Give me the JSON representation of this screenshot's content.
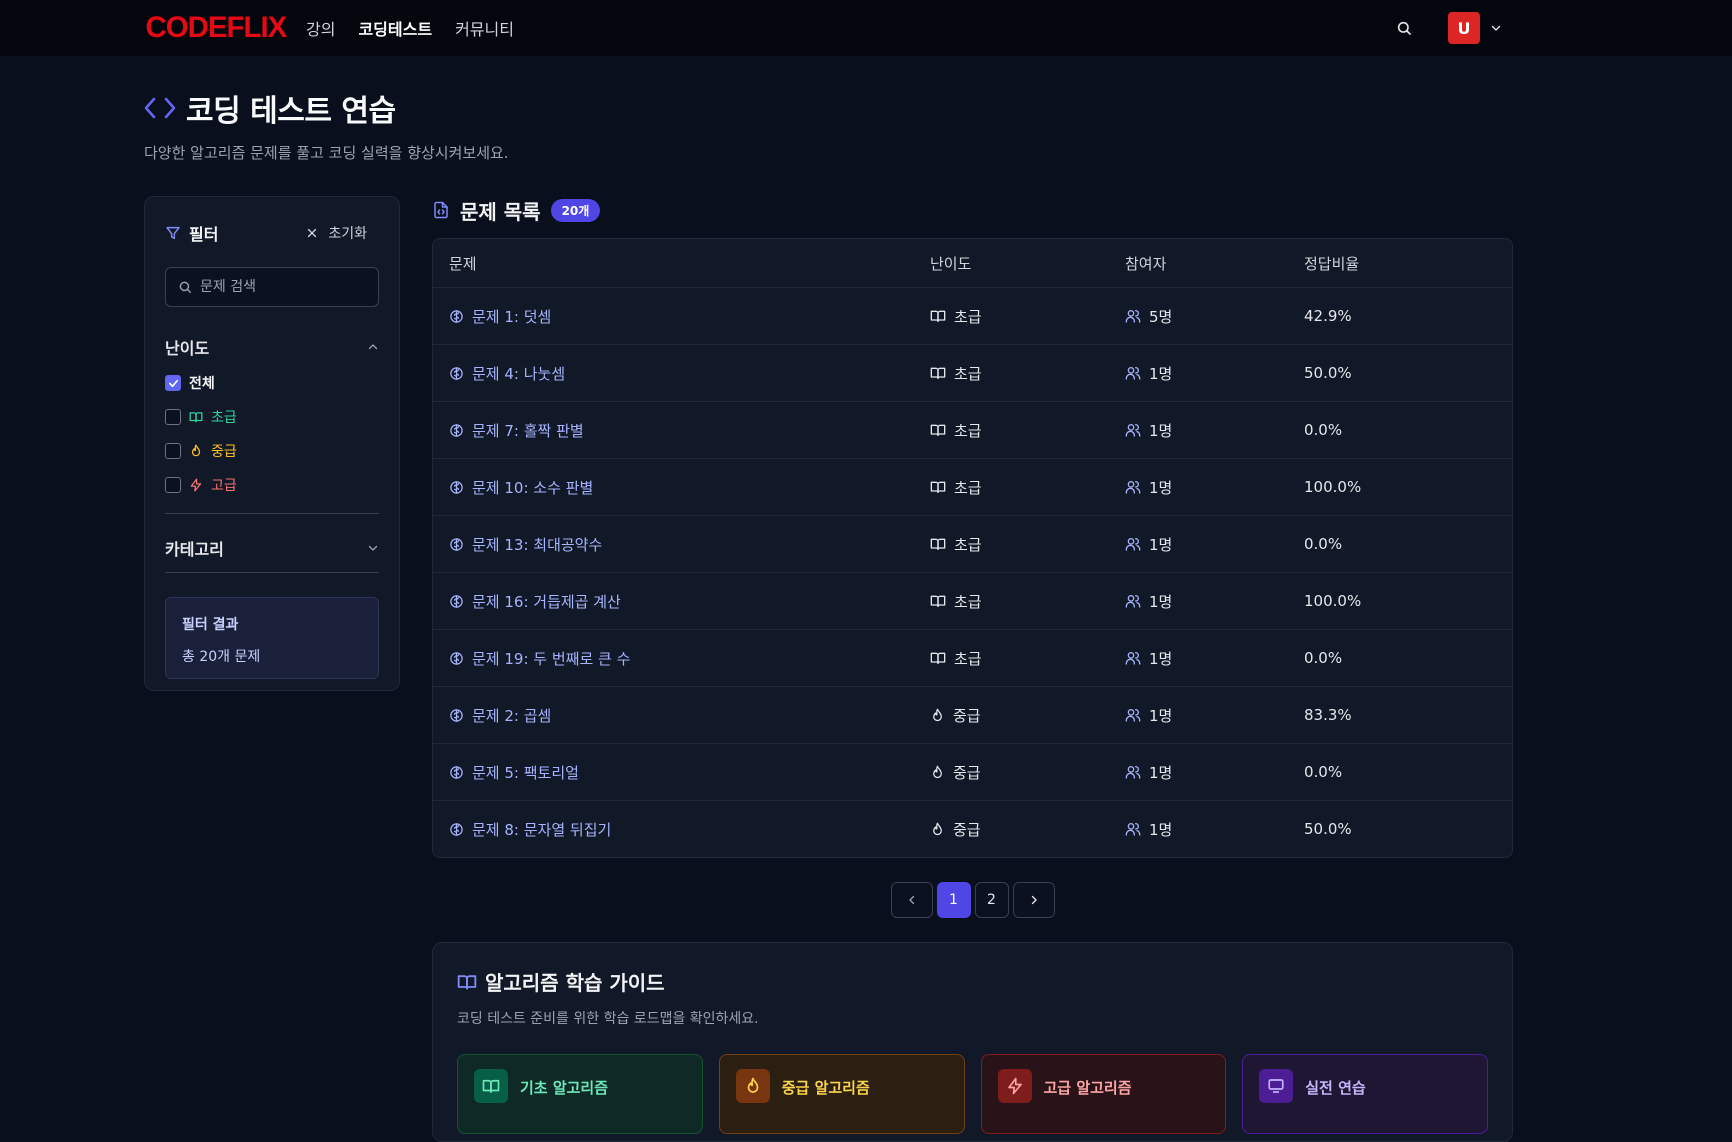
{
  "nav": {
    "logo": "CODEFLIX",
    "links": [
      "강의",
      "코딩테스트",
      "커뮤니티"
    ],
    "active_link": "코딩테스트",
    "avatar_letter": "U"
  },
  "header": {
    "title": "코딩 테스트 연습",
    "subtitle": "다양한 알고리즘 문제를 풀고 코딩 실력을 향상시켜보세요."
  },
  "sidebar": {
    "filter_title": "필터",
    "reset_label": "초기화",
    "search_placeholder": "문제 검색",
    "difficulty_label": "난이도",
    "options": [
      {
        "label": "전체",
        "checked": true
      },
      {
        "label": "초급",
        "checked": false
      },
      {
        "label": "중급",
        "checked": false
      },
      {
        "label": "고급",
        "checked": false
      }
    ],
    "category_label": "카테고리",
    "result_title": "필터 결과",
    "result_count": "총 20개 문제"
  },
  "list": {
    "title": "문제 목록",
    "badge": "20개",
    "columns": [
      "문제",
      "난이도",
      "참여자",
      "정답비율"
    ],
    "rows": [
      {
        "title": "문제 1: 덧셈",
        "difficulty": "초급",
        "participants": "5명",
        "rate": "42.9%"
      },
      {
        "title": "문제 4: 나눗셈",
        "difficulty": "초급",
        "participants": "1명",
        "rate": "50.0%"
      },
      {
        "title": "문제 7: 홀짝 판별",
        "difficulty": "초급",
        "participants": "1명",
        "rate": "0.0%"
      },
      {
        "title": "문제 10: 소수 판별",
        "difficulty": "초급",
        "participants": "1명",
        "rate": "100.0%"
      },
      {
        "title": "문제 13: 최대공약수",
        "difficulty": "초급",
        "participants": "1명",
        "rate": "0.0%"
      },
      {
        "title": "문제 16: 거듭제곱 계산",
        "difficulty": "초급",
        "participants": "1명",
        "rate": "100.0%"
      },
      {
        "title": "문제 19: 두 번째로 큰 수",
        "difficulty": "초급",
        "participants": "1명",
        "rate": "0.0%"
      },
      {
        "title": "문제 2: 곱셈",
        "difficulty": "중급",
        "participants": "1명",
        "rate": "83.3%"
      },
      {
        "title": "문제 5: 팩토리얼",
        "difficulty": "중급",
        "participants": "1명",
        "rate": "0.0%"
      },
      {
        "title": "문제 8: 문자열 뒤집기",
        "difficulty": "중급",
        "participants": "1명",
        "rate": "50.0%"
      }
    ]
  },
  "pagination": {
    "pages": [
      "1",
      "2"
    ],
    "current": "1"
  },
  "guide": {
    "title": "알고리즘 학습 가이드",
    "subtitle": "코딩 테스트 준비를 위한 학습 로드맵을 확인하세요.",
    "cards": [
      "기초 알고리즘",
      "중급 알고리즘",
      "고급 알고리즘",
      "실전 연습"
    ]
  },
  "colors": {
    "accent": "#4f46e5",
    "brand": "#e50914",
    "easy": "#34d399",
    "medium": "#fbbf24",
    "hard": "#f87171"
  }
}
